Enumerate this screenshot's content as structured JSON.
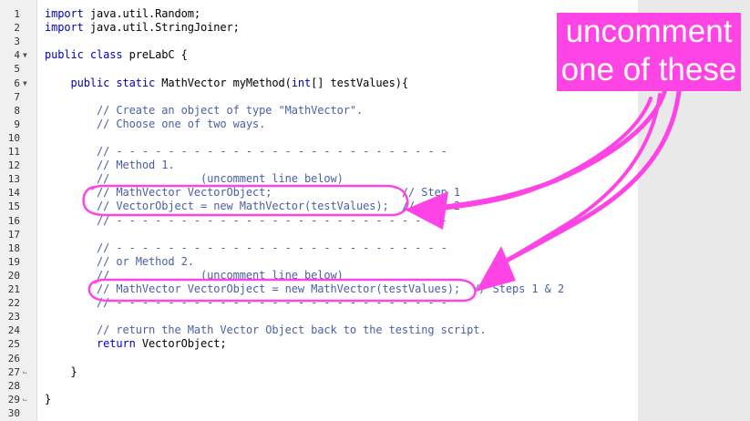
{
  "editor": {
    "gutter": [
      {
        "num": "1",
        "fold": ""
      },
      {
        "num": "2",
        "fold": ""
      },
      {
        "num": "3",
        "fold": ""
      },
      {
        "num": "4",
        "fold": "▼"
      },
      {
        "num": "5",
        "fold": ""
      },
      {
        "num": "6",
        "fold": "▼"
      },
      {
        "num": "7",
        "fold": ""
      },
      {
        "num": "8",
        "fold": ""
      },
      {
        "num": "9",
        "fold": ""
      },
      {
        "num": "10",
        "fold": ""
      },
      {
        "num": "11",
        "fold": ""
      },
      {
        "num": "12",
        "fold": ""
      },
      {
        "num": "13",
        "fold": ""
      },
      {
        "num": "14",
        "fold": ""
      },
      {
        "num": "15",
        "fold": ""
      },
      {
        "num": "16",
        "fold": ""
      },
      {
        "num": "17",
        "fold": ""
      },
      {
        "num": "18",
        "fold": ""
      },
      {
        "num": "19",
        "fold": ""
      },
      {
        "num": "20",
        "fold": ""
      },
      {
        "num": "21",
        "fold": ""
      },
      {
        "num": "22",
        "fold": ""
      },
      {
        "num": "23",
        "fold": ""
      },
      {
        "num": "24",
        "fold": ""
      },
      {
        "num": "25",
        "fold": ""
      },
      {
        "num": "26",
        "fold": ""
      },
      {
        "num": "27",
        "fold": "⌙"
      },
      {
        "num": "28",
        "fold": ""
      },
      {
        "num": "29",
        "fold": "⌙"
      },
      {
        "num": "30",
        "fold": ""
      }
    ],
    "code": [
      [
        {
          "t": "import",
          "c": "kw"
        },
        {
          "t": " java.util.Random;",
          "c": ""
        }
      ],
      [
        {
          "t": "import",
          "c": "kw"
        },
        {
          "t": " java.util.StringJoiner;",
          "c": ""
        }
      ],
      [],
      [
        {
          "t": "public class",
          "c": "kw"
        },
        {
          "t": " preLabC {",
          "c": ""
        }
      ],
      [],
      [
        {
          "t": "    ",
          "c": ""
        },
        {
          "t": "public static",
          "c": "kw"
        },
        {
          "t": " MathVector myMethod(",
          "c": ""
        },
        {
          "t": "int",
          "c": "kw"
        },
        {
          "t": "[] testValues){",
          "c": ""
        }
      ],
      [],
      [
        {
          "t": "        // Create an object of type \"MathVector\".",
          "c": "cm"
        }
      ],
      [
        {
          "t": "        // Choose one of two ways.",
          "c": "cm"
        }
      ],
      [],
      [
        {
          "t": "        // - - - - - - - - - - - - - - - - - - - - - - - - - -",
          "c": "cm"
        }
      ],
      [
        {
          "t": "        // Method 1.",
          "c": "cm"
        }
      ],
      [
        {
          "t": "        //              (uncomment line below)",
          "c": "cm"
        }
      ],
      [
        {
          "t": "        // MathVector VectorObject;                    // Step 1",
          "c": "cm"
        }
      ],
      [
        {
          "t": "        // VectorObject = new MathVector(testValues);  // Step 2",
          "c": "cm"
        }
      ],
      [
        {
          "t": "        // - - - - - - - - - - - - - - - - - - - - - - - - - -",
          "c": "cm"
        }
      ],
      [],
      [
        {
          "t": "        // - - - - - - - - - - - - - - - - - - - - - - - - - -",
          "c": "cm"
        }
      ],
      [
        {
          "t": "        // or Method 2.",
          "c": "cm"
        }
      ],
      [
        {
          "t": "        //              (uncomment line below)",
          "c": "cm"
        }
      ],
      [
        {
          "t": "        // MathVector VectorObject = new MathVector(testValues);  // Steps 1 & 2",
          "c": "cm"
        }
      ],
      [
        {
          "t": "        // - - - - - - - - - - - - - - - - - - - - - - - - - -",
          "c": "cm"
        }
      ],
      [],
      [
        {
          "t": "        // return the Math Vector Object back to the testing script.",
          "c": "cm"
        }
      ],
      [
        {
          "t": "        ",
          "c": ""
        },
        {
          "t": "return",
          "c": "kw"
        },
        {
          "t": " VectorObject;",
          "c": ""
        }
      ],
      [],
      [
        {
          "t": "    }",
          "c": ""
        }
      ],
      [],
      [
        {
          "t": "}",
          "c": ""
        }
      ],
      []
    ]
  },
  "annotation": {
    "line1": "uncomment",
    "line2": "one of these",
    "color": "#ff44e6"
  }
}
